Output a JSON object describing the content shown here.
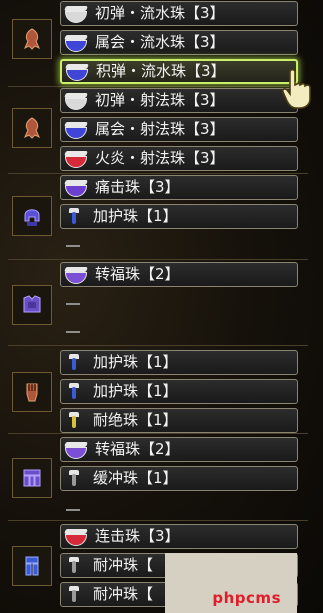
{
  "slots": [
    {
      "label": "初弹・流水珠【3】",
      "color": "#d9d9d9",
      "shape": "bowl"
    },
    {
      "label": "属会・流水珠【3】",
      "color": "#3f45d6",
      "shape": "bowl"
    },
    {
      "label": "积弹・流水珠【3】",
      "color": "#3f45d6",
      "shape": "bowl"
    },
    {
      "label": "初弹・射法珠【3】",
      "color": "#d9d9d9",
      "shape": "bowl"
    },
    {
      "label": "属会・射法珠【3】",
      "color": "#3f45d6",
      "shape": "bowl"
    },
    {
      "label": "火炎・射法珠【3】",
      "color": "#d62a3a",
      "shape": "bowl"
    },
    {
      "label": "痛击珠【3】",
      "color": "#6c3fd0",
      "shape": "bowl"
    },
    {
      "label": "加护珠【1】",
      "color": "#3a5ad6",
      "shape": "small"
    },
    {
      "label": "转福珠【2】",
      "color": "#7a4fd6",
      "shape": "bowl"
    },
    {
      "label": "加护珠【1】",
      "color": "#3a5ad6",
      "shape": "small"
    },
    {
      "label": "加护珠【1】",
      "color": "#3a5ad6",
      "shape": "small"
    },
    {
      "label": "耐绝珠【1】",
      "color": "#d6c23a",
      "shape": "small"
    },
    {
      "label": "转福珠【2】",
      "color": "#7a4fd6",
      "shape": "bowl"
    },
    {
      "label": "缓冲珠【1】",
      "color": "#9a9a9a",
      "shape": "small"
    },
    {
      "label": "连击珠【3】",
      "color": "#d62a3a",
      "shape": "bowl"
    },
    {
      "label": "耐冲珠【",
      "color": "#9a9a9a",
      "shape": "small"
    },
    {
      "label": "耐冲珠【",
      "color": "#9a9a9a",
      "shape": "small"
    }
  ],
  "selected_slot": 2,
  "equipment": [
    {
      "icon": "weapon-bow-icon",
      "color": "#b0563a"
    },
    {
      "icon": "weapon-bow-icon",
      "color": "#b0563a"
    },
    {
      "icon": "helm-armor-icon",
      "color": "#5a4fd6"
    },
    {
      "icon": "chest-armor-icon",
      "color": "#6a4fc8"
    },
    {
      "icon": "arm-armor-icon",
      "color": "#b0563a"
    },
    {
      "icon": "waist-armor-icon",
      "color": "#6a4fc8"
    },
    {
      "icon": "leg-armor-icon",
      "color": "#3a5ad6"
    }
  ],
  "watermark": "phpcms"
}
